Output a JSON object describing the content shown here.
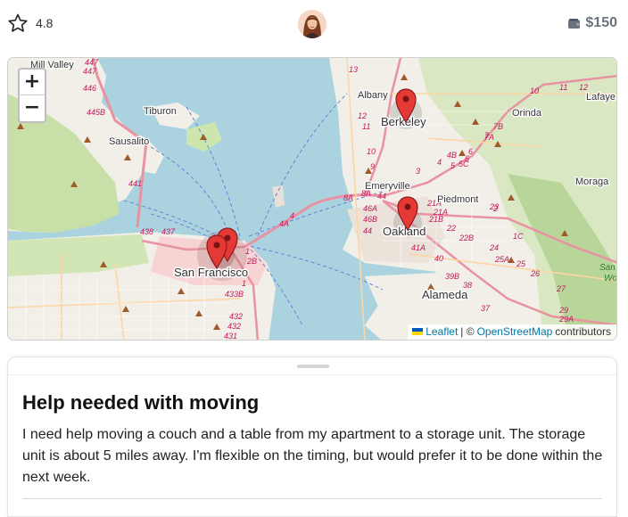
{
  "header": {
    "rating": "4.8",
    "balance": "$150"
  },
  "map": {
    "zoom_in": "+",
    "zoom_out": "−",
    "places": {
      "mill_valley": "Mill Valley",
      "tiburon": "Tiburon",
      "sausalito": "Sausalito",
      "san_francisco": "San Francisco",
      "albany": "Albany",
      "berkeley": "Berkeley",
      "emeryville": "Emeryville",
      "piedmont": "Piedmont",
      "oakland": "Oakland",
      "alameda": "Alameda",
      "orinda": "Orinda",
      "moraga": "Moraga",
      "lafaye": "Lafaye",
      "san_wo_1": "San",
      "san_wo_2": "Wo"
    },
    "routes": [
      "447",
      "447",
      "446",
      "445B",
      "441",
      "438",
      "437",
      "4",
      "4A",
      "2B",
      "1",
      "433B",
      "432",
      "432",
      "431",
      "13",
      "12",
      "11",
      "10",
      "9",
      "8A",
      "8A",
      "44",
      "46A",
      "46B",
      "44",
      "3",
      "4B",
      "5C",
      "6",
      "7",
      "7B",
      "7A",
      "21A",
      "21A",
      "21B",
      "22",
      "22B",
      "23",
      "1C",
      "24",
      "25A",
      "25",
      "26",
      "27",
      "29",
      "29A",
      "37",
      "38",
      "39B",
      "40",
      "41A",
      "10",
      "11",
      "12",
      "2",
      "1",
      "4",
      "5",
      "6"
    ],
    "attribution": {
      "leaflet": "Leaflet",
      "sep": "| ©",
      "osm": "OpenStreetMap",
      "contributors": "contributors"
    }
  },
  "task": {
    "title": "Help needed with moving",
    "description": "I need help moving a couch and a table from my apartment to a storage unit. The storage unit is about 5 miles away. I'm flexible on the timing, but would prefer it to be done within the next week."
  }
}
